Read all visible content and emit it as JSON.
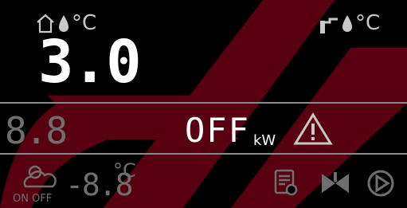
{
  "display": {
    "indoor": {
      "home_icon": "home-icon",
      "drop_icon": "water-drop-icon",
      "unit": "°C",
      "value": "3.0"
    },
    "outdoor_tap": {
      "tap_icon": "faucet-icon",
      "drop_icon": "water-drop-icon",
      "unit": "°C"
    },
    "middle": {
      "left_value": "8.8",
      "status": "OFF",
      "unit": "kW",
      "warning_icon": "warning-triangle-icon"
    },
    "bottom": {
      "weather_icon": "weather-sun-cloud-icon",
      "outdoor_value": "-8.8",
      "outdoor_unit": "°C",
      "on_label": "ON",
      "off_label": "OFF",
      "schedule_icon": "schedule-clipboard-icon",
      "valve_icon": "valve-icon",
      "pump_icon": "pump-icon"
    }
  },
  "colors": {
    "background": "#000000",
    "lit_segment": "#ffffff",
    "dim_segment": "#c8c8c8",
    "faint_segment": "#6f6f6f",
    "divider": "#8a8a8a",
    "watermark": "#a0001f"
  }
}
